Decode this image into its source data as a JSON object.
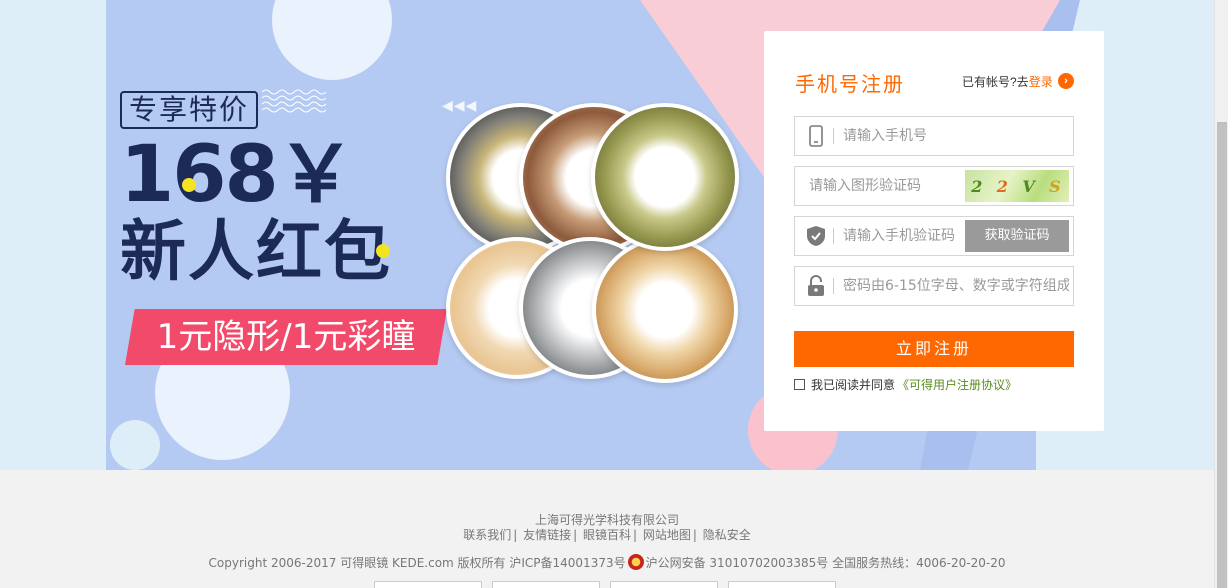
{
  "banner": {
    "tag": "专享特价",
    "price": "168￥",
    "headline": "新人红包",
    "ribbon": "1元隐形/1元彩瞳",
    "arrows": "◀◀◀"
  },
  "form": {
    "title": "手机号注册",
    "have_account": "已有帐号?去",
    "login_link": "登录",
    "phone_placeholder": "请输入手机号",
    "captcha_placeholder": "请输入图形验证码",
    "captcha_text": [
      "2",
      "2",
      "V",
      "S"
    ],
    "sms_placeholder": "请输入手机验证码",
    "sms_button": "获取验证码",
    "password_placeholder": "密码由6-15位字母、数字或字符组成",
    "submit": "立即注册",
    "agree_text": "我已阅读并同意",
    "agree_link": "《可得用户注册协议》"
  },
  "footer": {
    "company": "上海可得光学科技有限公司",
    "links": [
      "联系我们",
      "友情链接",
      "眼镜百科",
      "网站地图",
      "隐私安全"
    ],
    "copyright_left": "Copyright 2006-2017 可得眼镜 KEDE.com 版权所有 沪ICP备14001373号",
    "copyright_right": "沪公网安备 31010702003385号  全国服务热线：4006-20-20-20"
  },
  "colors": {
    "accent": "#ff6700",
    "navy": "#1c2a57",
    "ribbon": "#f24a6b",
    "agree_link": "#5a8c1e"
  },
  "icons": [
    "phone-icon",
    "shield-icon",
    "lock-icon",
    "chevron-right-icon",
    "police-badge-icon"
  ]
}
